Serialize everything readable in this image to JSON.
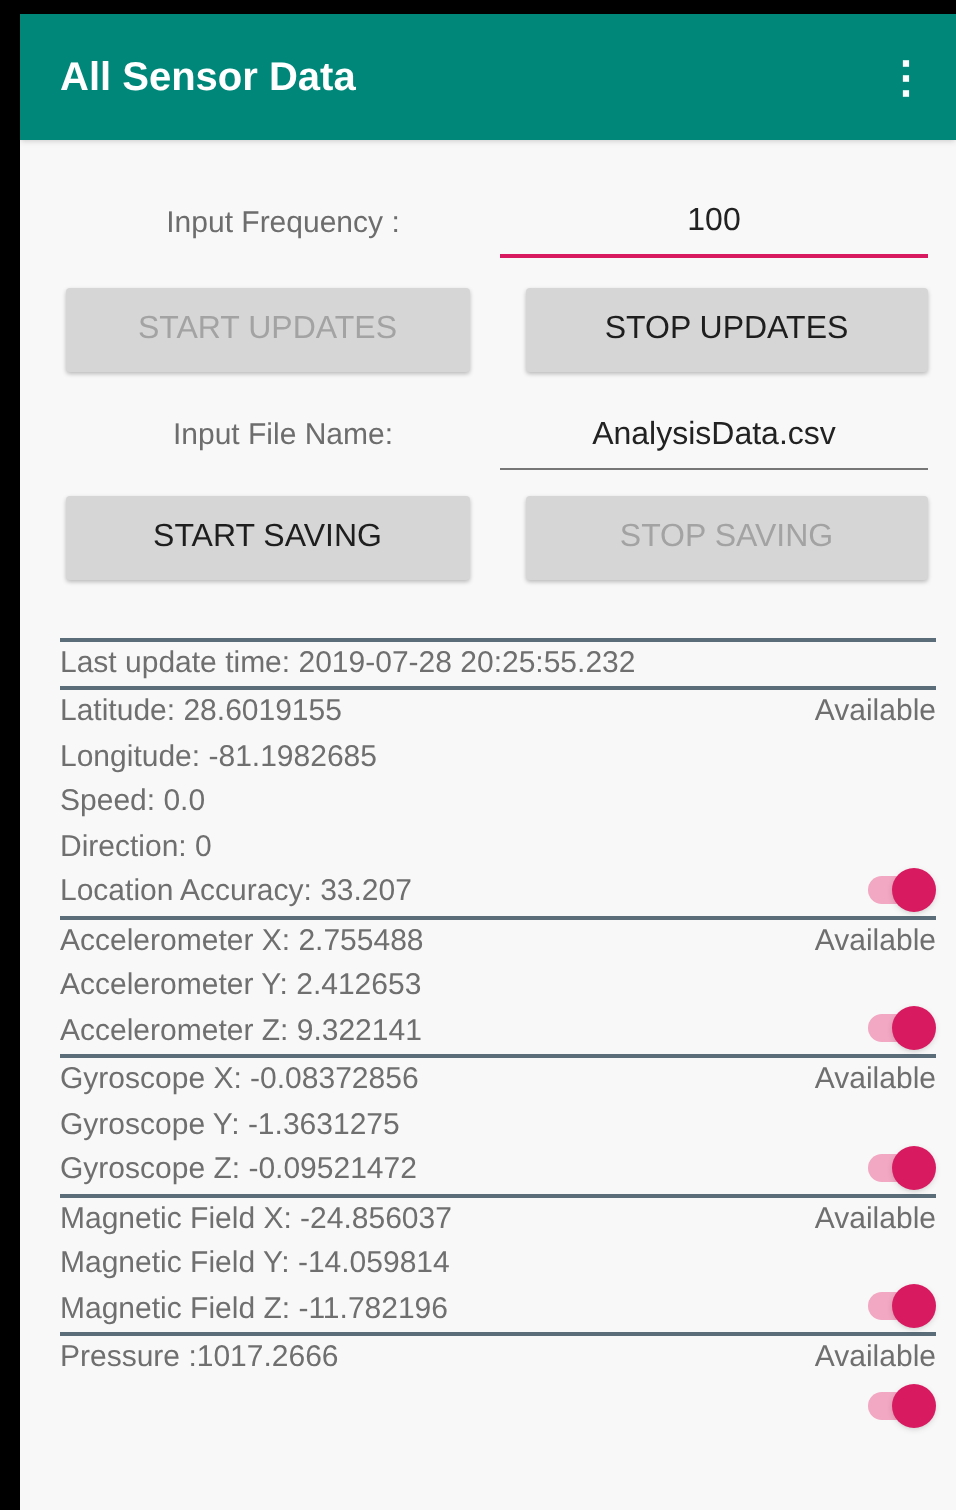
{
  "app_bar": {
    "title": "All Sensor Data",
    "menu": "⋮"
  },
  "frequency": {
    "label": "Input Frequency :",
    "value": "100",
    "focused": true
  },
  "update_buttons": [
    {
      "label": "START UPDATES",
      "disabled": true
    },
    {
      "label": "STOP UPDATES",
      "disabled": false
    }
  ],
  "file_name": {
    "label": "Input File Name:",
    "value": "AnalysisData.csv",
    "focused": false
  },
  "save_buttons": [
    {
      "label": "START SAVING",
      "disabled": false
    },
    {
      "label": "STOP SAVING",
      "disabled": true
    }
  ],
  "last_update": "Last update time: 2019-07-28 20:25:55.232",
  "sensors": [
    {
      "lines": [
        "Latitude: 28.6019155",
        "Longitude: -81.1982685",
        "Speed: 0.0",
        "Direction: 0",
        "Location Accuracy: 33.207"
      ],
      "status": "Available",
      "on": true
    },
    {
      "lines": [
        "Accelerometer X: 2.755488",
        "Accelerometer Y: 2.412653",
        "Accelerometer Z: 9.322141"
      ],
      "status": "Available",
      "on": true
    },
    {
      "lines": [
        "Gyroscope X: -0.08372856",
        "Gyroscope Y: -1.3631275",
        "Gyroscope Z: -0.09521472"
      ],
      "status": "Available",
      "on": true
    },
    {
      "lines": [
        "Magnetic Field X: -24.856037",
        "Magnetic Field Y: -14.059814",
        "Magnetic Field Z: -11.782196"
      ],
      "status": "Available",
      "on": true
    },
    {
      "lines": [
        "Pressure :1017.2666"
      ],
      "status": "Available",
      "on": true
    }
  ]
}
